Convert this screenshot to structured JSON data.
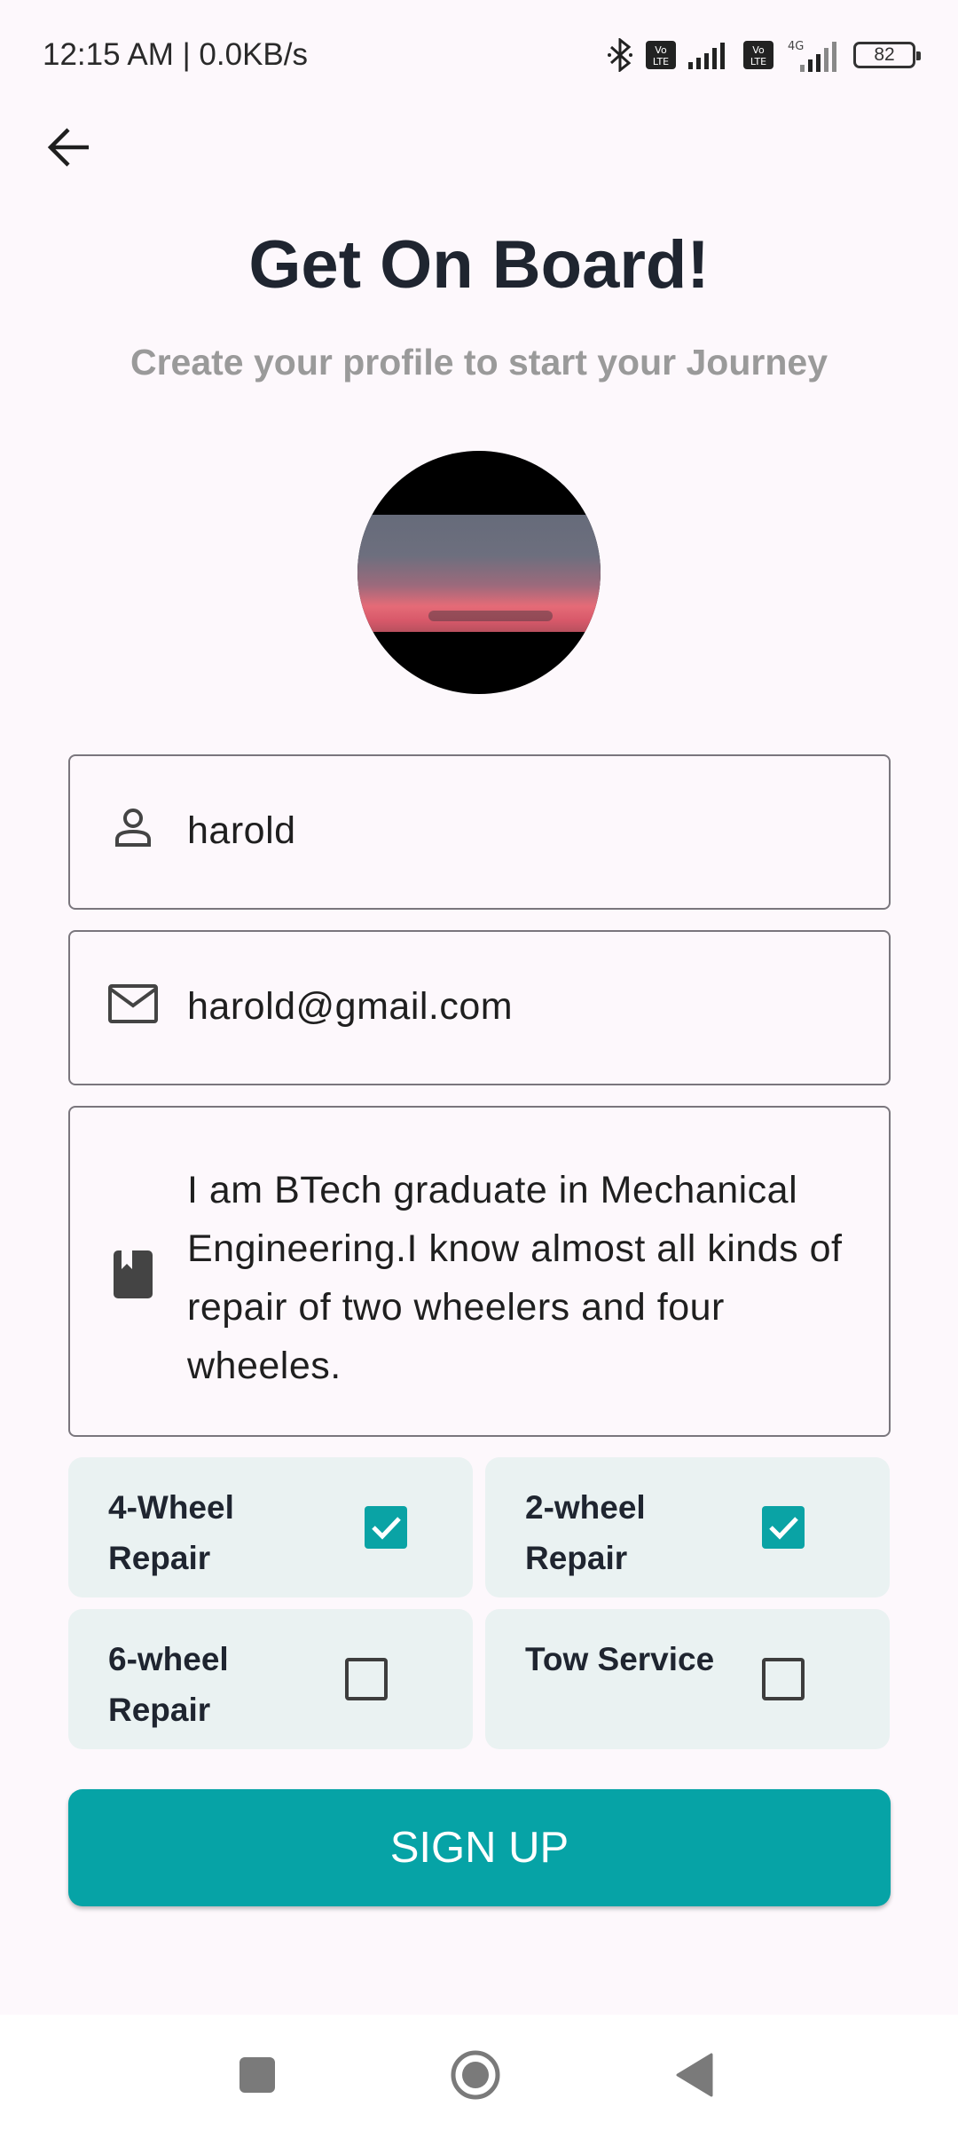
{
  "status_bar": {
    "time_speed": "12:15 AM | 0.0KB/s",
    "volte_1": "Vo LTE",
    "volte_2": "Vo LTE",
    "network": "4G",
    "battery": "82"
  },
  "header": {
    "title": "Get On Board!",
    "subtitle": "Create your profile to start your Journey"
  },
  "form": {
    "name": {
      "value": "harold",
      "icon": "person-icon"
    },
    "email": {
      "value": "harold@gmail.com",
      "icon": "mail-icon"
    },
    "bio": {
      "value": "I am BTech graduate in Mechanical Engineering.I know almost all kinds of repair of two wheelers and four wheeles.",
      "icon": "book-icon"
    }
  },
  "services": [
    {
      "label": "4-Wheel Repair",
      "checked": true
    },
    {
      "label": "2-wheel Repair",
      "checked": true
    },
    {
      "label": "6-wheel Repair",
      "checked": false
    },
    {
      "label": "Tow Service",
      "checked": false
    }
  ],
  "signup_label": "SIGN UP",
  "colors": {
    "accent": "#06a3a6",
    "background": "#fdf8fc",
    "service_bg": "#eaf2f2",
    "title": "#1f2530",
    "subtitle": "#9a9a9a"
  }
}
